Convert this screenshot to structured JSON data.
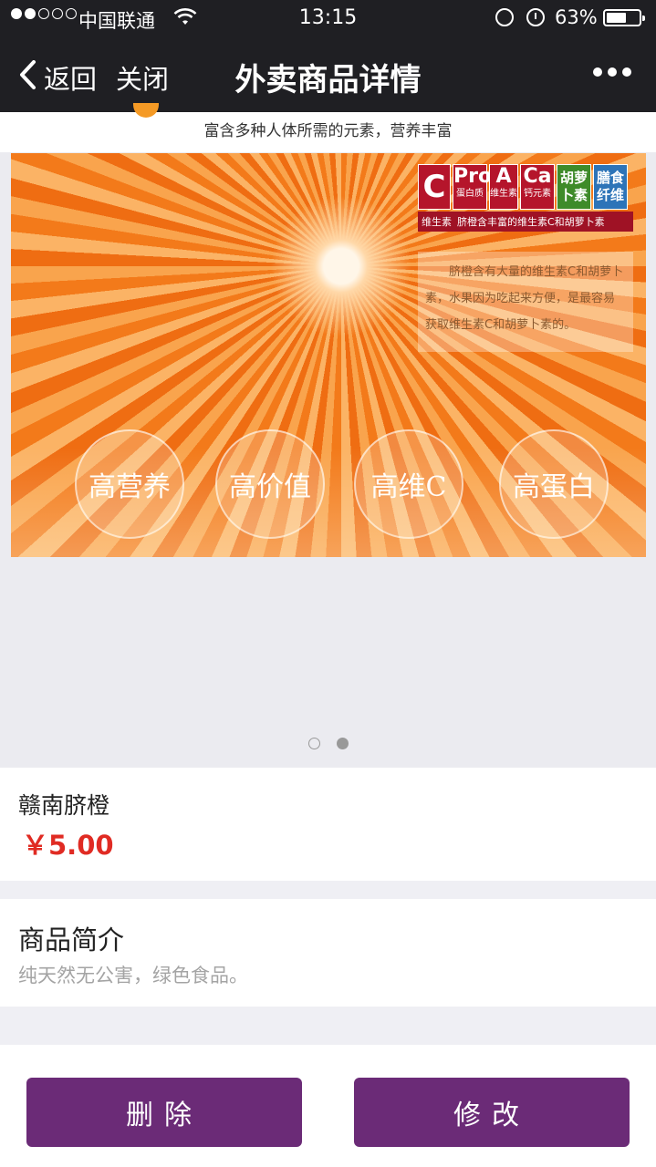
{
  "status_bar": {
    "signal_dots": 5,
    "signal_strength": 2,
    "carrier": "中国联通",
    "time": "13:15",
    "battery_text": "63%",
    "battery_level": 0.63
  },
  "nav": {
    "back_label": "返回",
    "close_label": "关闭",
    "title": "外卖商品详情"
  },
  "gallery": {
    "caption": "富含多种人体所需的元素，营养丰富",
    "badges": {
      "c_big": "C",
      "c_small": "维生素",
      "pro_big": "Pro",
      "pro_small": "蛋白质",
      "a_big": "A",
      "a_small": "维生素",
      "ca_big": "Ca",
      "ca_small": "钙元素",
      "carotene": "胡萝卜素",
      "fiber": "膳食纤维",
      "subtitle": "脐橙含丰富的维生素C和胡萝卜素"
    },
    "description": "脐橙含有大量的维生素C和胡萝卜素，水果因为吃起来方便，是最容易获取维生素C和胡萝卜素的。",
    "bubbles": [
      "高营养",
      "高价值",
      "高维C",
      "高蛋白"
    ],
    "page_count": 2,
    "active_page": 2
  },
  "product": {
    "name": "赣南脐橙",
    "price": "￥5.00"
  },
  "intro": {
    "heading": "商品简介",
    "text": "纯天然无公害，绿色食品。"
  },
  "actions": {
    "delete_label": "删除",
    "edit_label": "修改"
  },
  "colors": {
    "nav_bg": "#1f1f23",
    "accent_button": "#6b2b77",
    "price": "#e02b23"
  }
}
